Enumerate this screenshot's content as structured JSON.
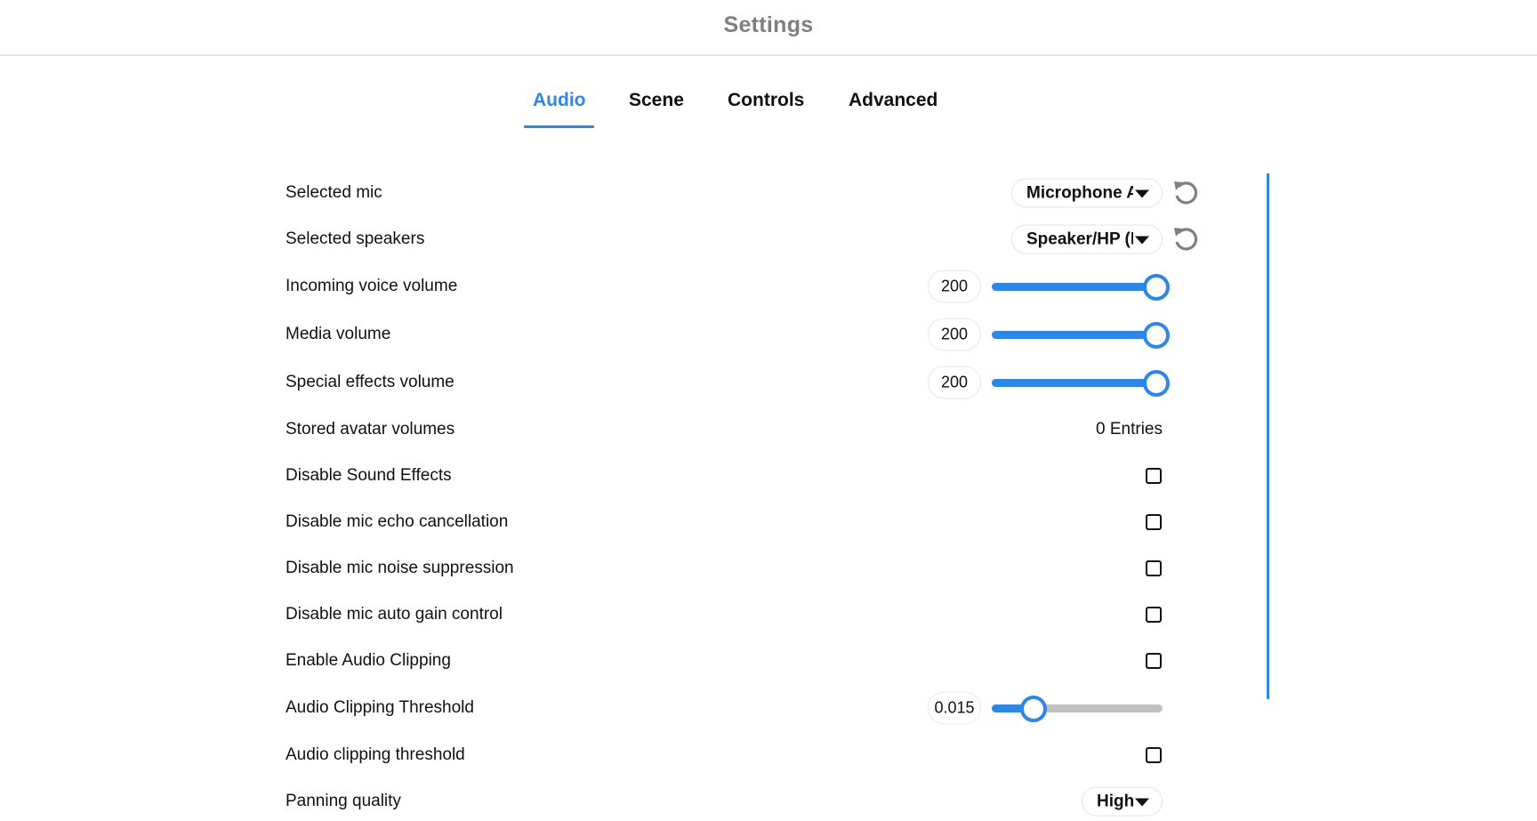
{
  "header": {
    "title": "Settings"
  },
  "tabs": [
    {
      "label": "Audio",
      "active": true
    },
    {
      "label": "Scene",
      "active": false
    },
    {
      "label": "Controls",
      "active": false
    },
    {
      "label": "Advanced",
      "active": false
    }
  ],
  "accent_color": "#2e86e6",
  "settings": {
    "selected_mic": {
      "label": "Selected mic",
      "value": "Microphone Array",
      "reset_icon": "reset-icon"
    },
    "selected_speakers": {
      "label": "Selected speakers",
      "value": "Speaker/HP (Realtek)",
      "reset_icon": "reset-icon"
    },
    "incoming_voice_volume": {
      "label": "Incoming voice volume",
      "value": "200",
      "fraction": 1.0
    },
    "media_volume": {
      "label": "Media volume",
      "value": "200",
      "fraction": 1.0
    },
    "special_effects_volume": {
      "label": "Special effects volume",
      "value": "200",
      "fraction": 1.0
    },
    "stored_avatar_volumes": {
      "label": "Stored avatar volumes",
      "value": "0 Entries"
    },
    "disable_sound_effects": {
      "label": "Disable Sound Effects",
      "checked": false
    },
    "disable_mic_echo_cancellation": {
      "label": "Disable mic echo cancellation",
      "checked": false
    },
    "disable_mic_noise_suppression": {
      "label": "Disable mic noise suppression",
      "checked": false
    },
    "disable_mic_auto_gain_control": {
      "label": "Disable mic auto gain control",
      "checked": false
    },
    "enable_audio_clipping": {
      "label": "Enable Audio Clipping",
      "checked": false
    },
    "audio_clipping_threshold_slider": {
      "label": "Audio Clipping Threshold",
      "value": "0.015",
      "fraction": 0.18
    },
    "audio_clipping_threshold_checkbox": {
      "label": "Audio clipping threshold",
      "checked": false
    },
    "panning_quality": {
      "label": "Panning quality",
      "value": "High"
    }
  }
}
